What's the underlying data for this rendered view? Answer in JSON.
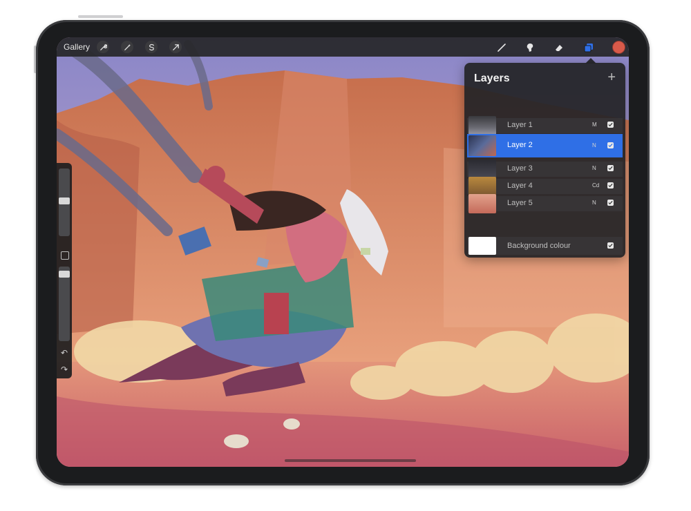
{
  "toolbar": {
    "gallery_label": "Gallery",
    "left_tools": [
      "wrench-icon",
      "magic-wand-icon",
      "selection-s-icon",
      "transform-arrow-icon"
    ],
    "right_tools": [
      "brush-icon",
      "smudge-icon",
      "eraser-icon",
      "layers-icon"
    ],
    "active_tool": "layers-icon",
    "current_color": "#d85a4a"
  },
  "sidebar": {
    "size_slider_value": 0.2,
    "opacity_slider_value": 0.1,
    "undo_icon": "undo-icon",
    "redo_icon": "redo-icon"
  },
  "layers_panel": {
    "title": "Layers",
    "add_icon": "+",
    "layers": [
      {
        "name": "Layer 1",
        "mode": "M",
        "visible": true,
        "active": false
      },
      {
        "name": "Layer 2",
        "mode": "N",
        "visible": true,
        "active": true
      },
      {
        "name": "Layer 3",
        "mode": "N",
        "visible": true,
        "active": false
      },
      {
        "name": "Layer 4",
        "mode": "Cd",
        "visible": true,
        "active": false
      },
      {
        "name": "Layer 5",
        "mode": "N",
        "visible": true,
        "active": false
      }
    ],
    "background": {
      "name": "Background colour",
      "visible": true,
      "color": "#ffffff"
    }
  },
  "colors": {
    "accent": "#2f6fe6",
    "toolbar_bg": "#262628",
    "panel_bg": "#242427"
  }
}
